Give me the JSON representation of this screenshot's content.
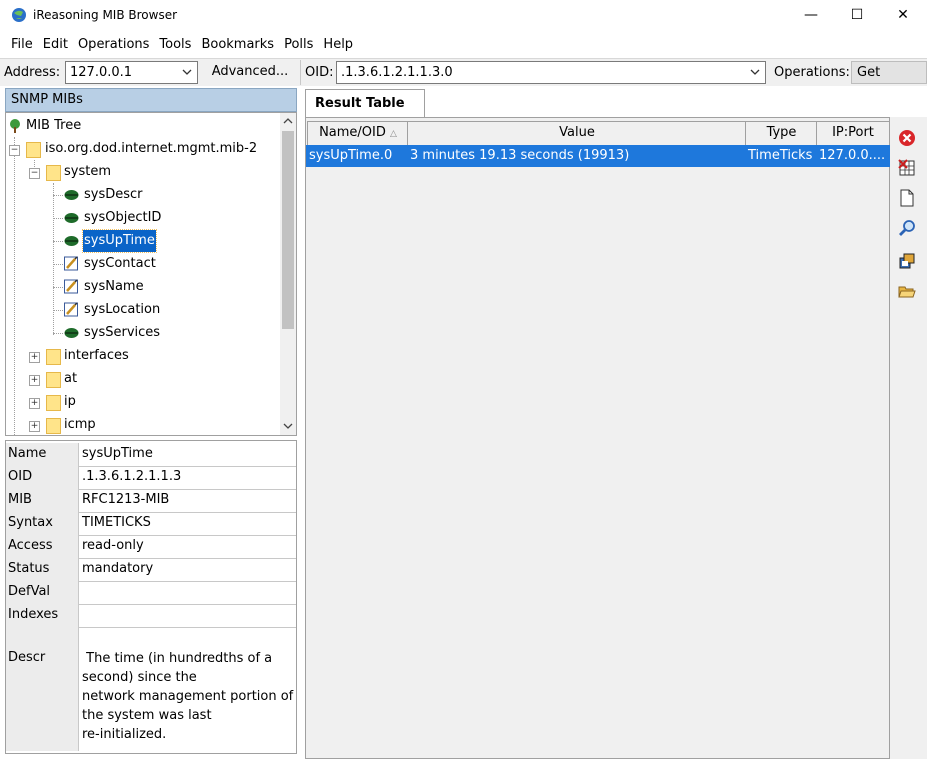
{
  "window": {
    "title": "iReasoning MIB Browser",
    "controls": {
      "minimize": "—",
      "maximize": "☐",
      "close": "✕"
    }
  },
  "menu": [
    "File",
    "Edit",
    "Operations",
    "Tools",
    "Bookmarks",
    "Polls",
    "Help"
  ],
  "toolbar": {
    "address_label": "Address:",
    "address_value": "127.0.0.1",
    "advanced_label": "Advanced...",
    "oid_label": "OID:",
    "oid_value": ".1.3.6.1.2.1.1.3.0",
    "operations_label": "Operations:",
    "operations_value": "Get"
  },
  "left_panel": {
    "header": "SNMP MIBs",
    "tree": {
      "root": "MIB Tree",
      "mib2": "iso.org.dod.internet.mgmt.mib-2",
      "system": "system",
      "system_children": [
        "sysDescr",
        "sysObjectID",
        "sysUpTime",
        "sysContact",
        "sysName",
        "sysLocation",
        "sysServices"
      ],
      "selected": "sysUpTime",
      "folders": [
        "interfaces",
        "at",
        "ip",
        "icmp"
      ]
    },
    "properties": [
      {
        "key": "Name",
        "value": "sysUpTime"
      },
      {
        "key": "OID",
        "value": ".1.3.6.1.2.1.1.3"
      },
      {
        "key": "MIB",
        "value": "RFC1213-MIB"
      },
      {
        "key": "Syntax",
        "value": "TIMETICKS"
      },
      {
        "key": "Access",
        "value": "read-only"
      },
      {
        "key": "Status",
        "value": "mandatory"
      },
      {
        "key": "DefVal",
        "value": ""
      },
      {
        "key": "Indexes",
        "value": ""
      },
      {
        "key": "Descr",
        "value_lines": [
          " The time (in hundredths of a",
          "second) since the",
          "network management portion of",
          "the system was last",
          "re-initialized."
        ]
      }
    ]
  },
  "result": {
    "tab": "Result Table",
    "columns": [
      "Name/OID",
      "Value",
      "Type",
      "IP:Port"
    ],
    "sort_indicator": "△",
    "rows": [
      {
        "name": "sysUpTime.0",
        "value": "3 minutes 19.13 seconds (19913)",
        "type": "TimeTicks",
        "ipport": "127.0.0...."
      }
    ]
  },
  "sidebar_icons": [
    "delete-icon",
    "clear-table-icon",
    "new-document-icon",
    "find-icon",
    "export-icon",
    "open-folder-icon"
  ],
  "colors": {
    "selection": "#1e78dc",
    "header": "#b8cfe5",
    "leaf": "#1e6b2a"
  }
}
